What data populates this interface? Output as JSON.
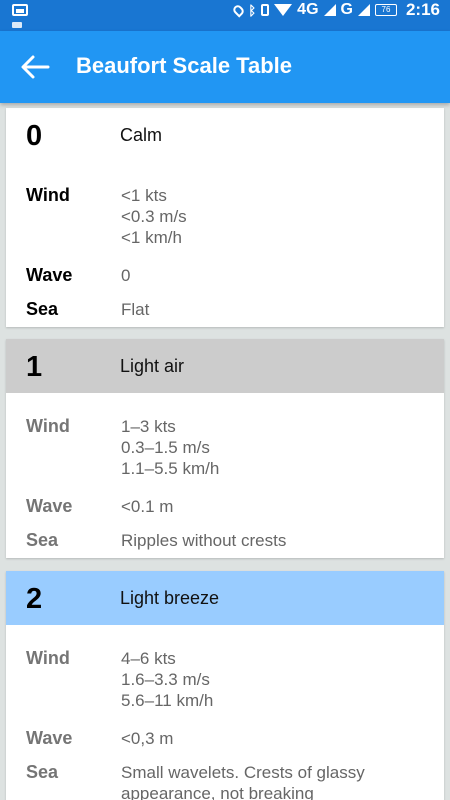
{
  "status_bar": {
    "network_1": "4G",
    "network_2": "G",
    "battery": "76",
    "time": "2:16"
  },
  "app_bar": {
    "title": "Beaufort Scale Table"
  },
  "labels": {
    "wind": "Wind",
    "wave": "Wave",
    "sea": "Sea"
  },
  "scale": [
    {
      "force": "0",
      "name": "Calm",
      "wind_kts": "<1 kts",
      "wind_ms": "<0.3 m/s",
      "wind_kmh": "<1 km/h",
      "wave": "0",
      "sea": "Flat",
      "header_color": "#ffffff"
    },
    {
      "force": "1",
      "name": "Light air",
      "wind_kts": "1–3 kts",
      "wind_ms": "0.3–1.5 m/s",
      "wind_kmh": "1.1–5.5 km/h",
      "wave": "<0.1 m",
      "sea": "Ripples without crests",
      "header_color": "#cccccc"
    },
    {
      "force": "2",
      "name": "Light breeze",
      "wind_kts": "4–6 kts",
      "wind_ms": "1.6–3.3 m/s",
      "wind_kmh": "5.6–11 km/h",
      "wave": "<0,3 m",
      "sea_line1": "Small wavelets. Crests of glassy",
      "sea_line2": "appearance, not breaking",
      "header_color": "#99ccff"
    }
  ],
  "colors": {
    "status_bar": "#1976d2",
    "app_bar": "#2196f3",
    "background": "#dde2e1"
  }
}
